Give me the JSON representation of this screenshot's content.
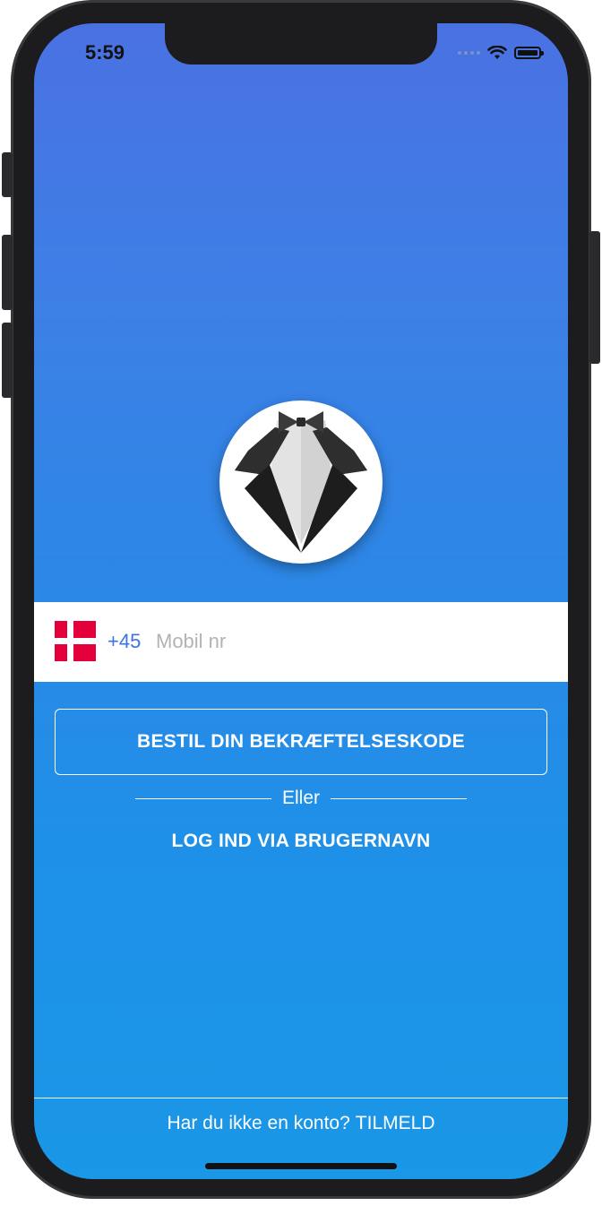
{
  "status_bar": {
    "time": "5:59",
    "icons": [
      "cellular-dots-icon",
      "wifi-icon",
      "battery-icon"
    ]
  },
  "phone": {
    "country_flag": "denmark-flag-icon",
    "country_code": "+45",
    "placeholder": "Mobil nr",
    "value": ""
  },
  "actions": {
    "request_code_label": "BESTIL DIN BEKRÆFTELSESKODE",
    "divider_label": "Eller",
    "username_login_label": "LOG IND VIA BRUGERNAVN"
  },
  "footer": {
    "prompt": "Har du ikke en konto?",
    "signup_label": "TILMELD"
  },
  "colors": {
    "gradient_top": "#4a71e2",
    "gradient_bottom": "#1a97e7",
    "country_code": "#3c73e4",
    "flag_red": "#e4003a"
  }
}
